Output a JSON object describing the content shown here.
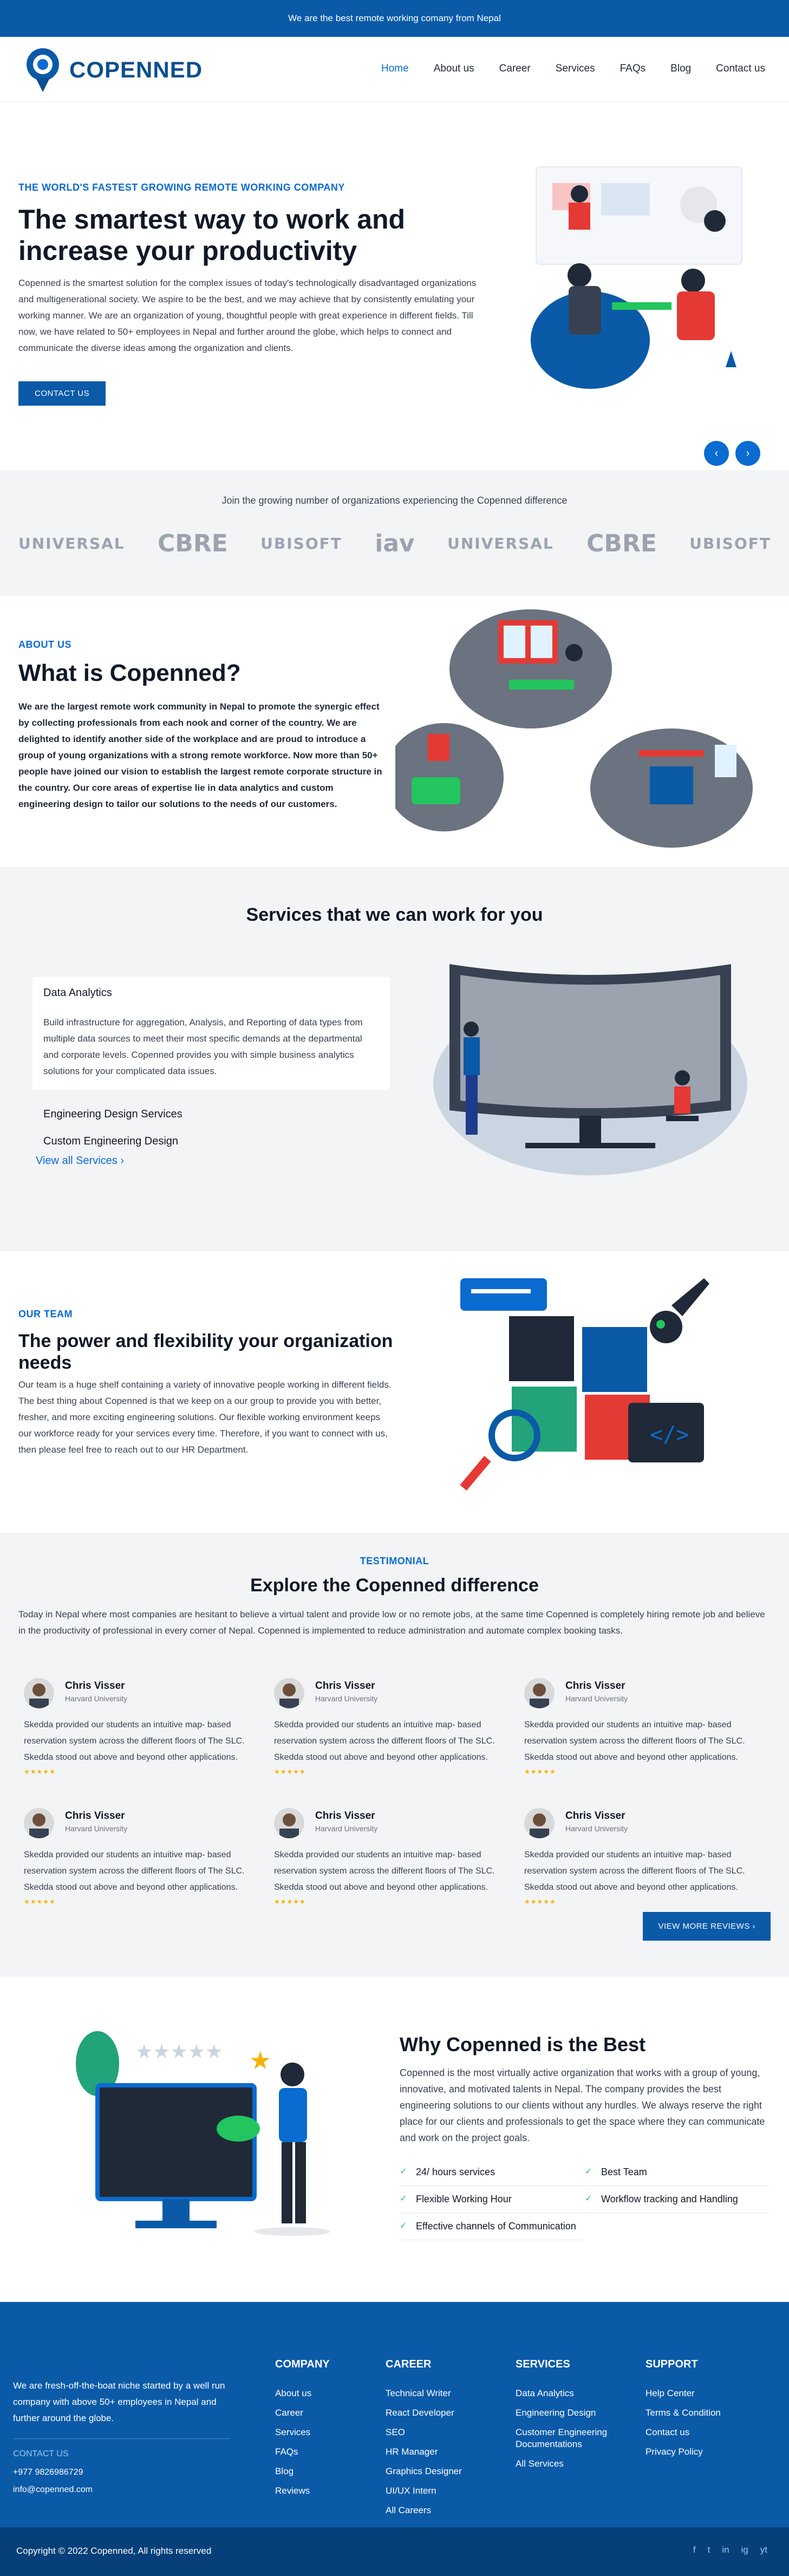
{
  "topbar": {
    "text": "We are the best remote working comany from Nepal"
  },
  "nav": {
    "brand": "COPENNED",
    "items": [
      "Home",
      "About us",
      "Career",
      "Services",
      "FAQs",
      "Blog",
      "Contact us"
    ],
    "active": "Home"
  },
  "hero": {
    "label": "THE WORLD'S FASTEST GROWING REMOTE WORKING COMPANY",
    "title": "The smartest way to work and increase your productivity",
    "text": "Copenned is the smartest solution for the complex issues of today's technologically disadvantaged organizations and multigenerational society. We aspire to be the best, and we may achieve that by consistently emulating your working manner. We are an organization of young, thoughtful people with great experience in different fields. Till now, we have related to 50+ employees in Nepal and further around the globe, which helps to connect and communicate the diverse ideas among the organization and clients.",
    "cta": "CONTACT US",
    "prev_icon": "‹",
    "next_icon": "›"
  },
  "clients": {
    "caption": "Join the growing number of organizations experiencing the Copenned difference",
    "logos": [
      "UNIVERSAL",
      "CBRE",
      "UBISOFT",
      "iav",
      "UNIVERSAL",
      "CBRE",
      "UBISOFT"
    ]
  },
  "about": {
    "label": "ABOUT US",
    "title": "What is Copenned?",
    "text": "We are the largest remote work community in Nepal to promote the synergic effect by collecting professionals from each nook and corner of the country. We are delighted to identify another side of the workplace and are proud to introduce a group of young organizations with a strong remote workforce. Now more than 50+ people have joined our vision to establish the largest remote corporate structure in the country. Our core areas of expertise lie in data analytics and custom engineering design to tailor our solutions to the needs of our customers."
  },
  "services": {
    "title": "Services that we can work for you",
    "card_title": "Data Analytics",
    "card_text": "Build infrastructure for aggregation, Analysis, and Reporting of data types from multiple data sources to meet their most specific demands at the departmental and corporate levels. Copenned provides you with simple business analytics solutions for your complicated data issues.",
    "items": [
      "Engineering Design Services",
      "Custom Engineering Design"
    ],
    "view_all": "View all Services  ›"
  },
  "team": {
    "label": "OUR TEAM",
    "title": "The power and flexibility your organization needs",
    "text": "Our team is a huge shelf containing a variety of innovative people working in different fields. The best thing about Copenned is that we keep on a our group to provide you with better, fresher, and more exciting engineering solutions. Our flexible working environment keeps our workforce ready for your services every time. Therefore, if you want to connect with us, then please feel free to reach out to our HR Department."
  },
  "testimonials": {
    "label": "TESTIMONIAL",
    "title": "Explore the Copenned difference",
    "intro": "Today in Nepal where most companies are hesitant to believe a virtual talent and provide low or no remote jobs, at the same time Copenned is completely hiring remote job and believe in the productivity of professional in every corner of Nepal. Copenned is implemented to reduce administration and automate complex booking tasks.",
    "reviews": [
      {
        "name": "Chris Visser",
        "school": "Harvard University",
        "text": "Skedda provided our students an intuitive map- based reservation system across the different floors of The SLC. Skedda stood out above and beyond other applications.",
        "stars": "★★★★★"
      },
      {
        "name": "Chris Visser",
        "school": "Harvard University",
        "text": "Skedda provided our students an intuitive map- based reservation system across the different floors of The SLC. Skedda stood out above and beyond other applications.",
        "stars": "★★★★★"
      },
      {
        "name": "Chris Visser",
        "school": "Harvard University",
        "text": "Skedda provided our students an intuitive map- based reservation system across the different floors of The SLC. Skedda stood out above and beyond other applications.",
        "stars": "★★★★★"
      },
      {
        "name": "Chris Visser",
        "school": "Harvard University",
        "text": "Skedda provided our students an intuitive map- based reservation system across the different floors of The SLC. Skedda stood out above and beyond other applications.",
        "stars": "★★★★★"
      },
      {
        "name": "Chris Visser",
        "school": "Harvard University",
        "text": "Skedda provided our students an intuitive map- based reservation system across the different floors of The SLC. Skedda stood out above and beyond other applications.",
        "stars": "★★★★★"
      },
      {
        "name": "Chris Visser",
        "school": "Harvard University",
        "text": "Skedda provided our students an intuitive map- based reservation system across the different floors of The SLC. Skedda stood out above and beyond other applications.",
        "stars": "★★★★★"
      }
    ],
    "more_button": "VIEW MORE REVIEWS  ›"
  },
  "why": {
    "title": "Why Copenned is the Best",
    "text": "Copenned is the most virtually active organization that works with a group of young, innovative, and motivated talents in Nepal. The company provides the best engineering solutions to our clients without any hurdles. We always reserve the right place for our clients and professionals to get the space where they can communicate and work on the project goals.",
    "features": [
      "24/ hours services",
      "Best Team",
      "Flexible Working Hour",
      "Workflow tracking and Handling",
      "Effective channels of Communication"
    ]
  },
  "footer": {
    "about": "We are fresh-off-the-boat niche started by a well run company with above 50+ employees in Nepal and further around the globe.",
    "contact_label": "CONTACT US",
    "phone": "+977 9826986729",
    "email": "info@copenned.com",
    "columns": [
      {
        "title": "COMPANY",
        "links": [
          "About us",
          "Career",
          "Services",
          "FAQs",
          "Blog",
          "Reviews"
        ]
      },
      {
        "title": "CAREER",
        "links": [
          "Technical Writer",
          "React Developer",
          "SEO",
          "HR Manager",
          "Graphics Designer",
          "UI/UX Intern",
          "All Careers"
        ]
      },
      {
        "title": "SERVICES",
        "links": [
          "Data Analytics",
          "Engineering Design",
          "Customer Engineering Documentations",
          "All Services"
        ]
      },
      {
        "title": "SUPPORT",
        "links": [
          "Help Center",
          "Terms & Condition",
          "Contact us",
          "Privacy Policy"
        ]
      }
    ],
    "copyright": "Copyright © 2022 Copenned, All rights reserved",
    "social_icons": [
      "f",
      "t",
      "in",
      "ig",
      "yt"
    ]
  },
  "colors": {
    "brand": "#0a5aa8",
    "accent": "#0a6bd0",
    "star": "#f5b301",
    "tick": "#22c55e"
  }
}
